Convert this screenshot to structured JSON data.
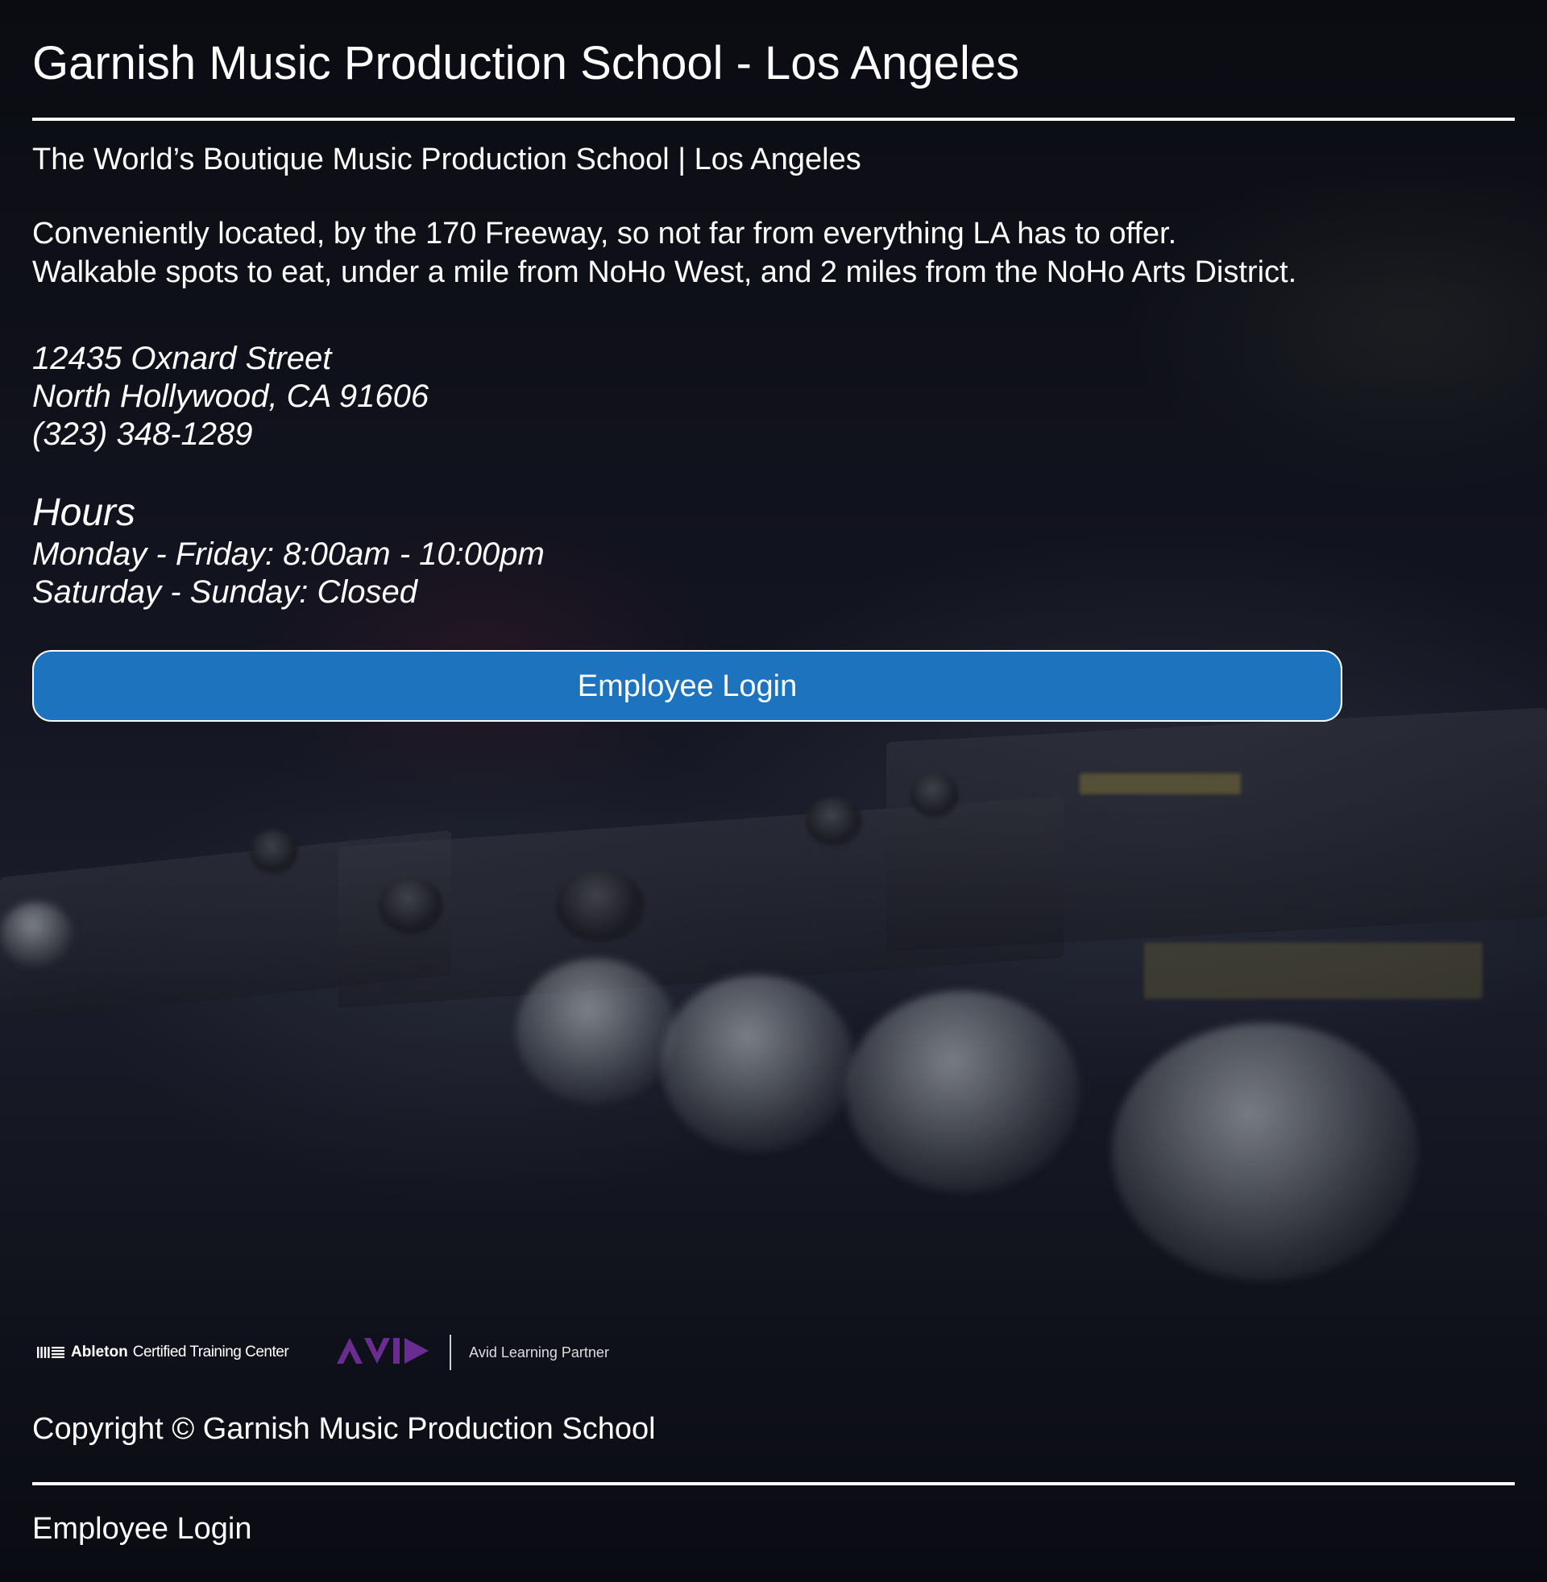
{
  "header": {
    "title": "Garnish Music Production School - Los Angeles"
  },
  "intro": {
    "tagline": "The World’s Boutique Music Production School | Los Angeles",
    "description_lines": [
      "Conveniently located, by the 170 Freeway, so not far from everything LA has to offer.",
      "Walkable spots to eat, under a mile from NoHo West, and 2 miles from the NoHo Arts District."
    ]
  },
  "contact": {
    "street": "12435 Oxnard Street",
    "city_line": "North Hollywood, CA 91606",
    "phone": "(323) 348-1289"
  },
  "hours": {
    "heading": "Hours",
    "lines": [
      "Monday - Friday: 8:00am - 10:00pm",
      "Saturday - Sunday: Closed"
    ]
  },
  "actions": {
    "employee_login_button": "Employee Login"
  },
  "partners": {
    "ableton_name": "Ableton",
    "ableton_subtitle": "Certified Training Center",
    "avid_name": "AVID",
    "avid_subtitle": "Avid Learning Partner"
  },
  "footer": {
    "copyright": "Copyright © Garnish Music Production School",
    "employee_login_link": "Employee Login"
  },
  "colors": {
    "button_bg": "#1e73be",
    "text": "#ffffff",
    "avid_purple": "#6a2c91"
  }
}
